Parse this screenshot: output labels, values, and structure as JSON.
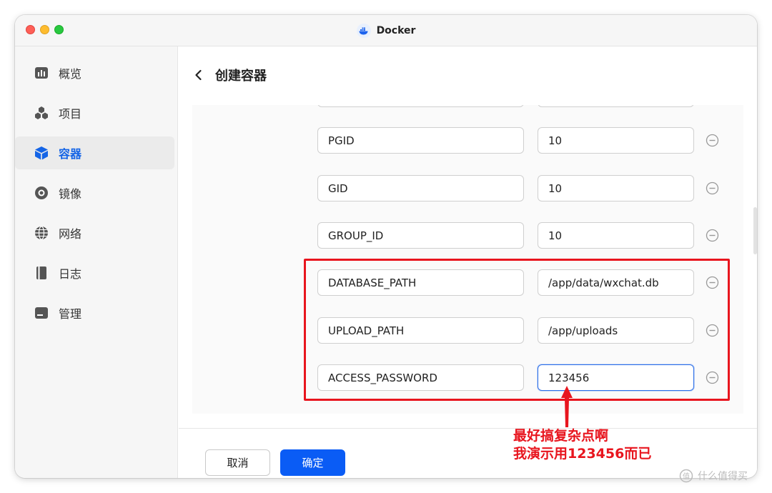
{
  "window": {
    "title": "Docker"
  },
  "sidebar": {
    "items": [
      {
        "label": "概览",
        "icon": "overview-chart-icon",
        "active": false
      },
      {
        "label": "项目",
        "icon": "project-cubes-icon",
        "active": false
      },
      {
        "label": "容器",
        "icon": "container-box-icon",
        "active": true
      },
      {
        "label": "镜像",
        "icon": "image-disc-icon",
        "active": false
      },
      {
        "label": "网络",
        "icon": "network-globe-icon",
        "active": false
      },
      {
        "label": "日志",
        "icon": "log-book-icon",
        "active": false
      },
      {
        "label": "管理",
        "icon": "manage-drive-icon",
        "active": false
      }
    ]
  },
  "header": {
    "title": "创建容器"
  },
  "env": {
    "rows": [
      {
        "key": "PGID",
        "value": "10",
        "focused": false
      },
      {
        "key": "GID",
        "value": "10",
        "focused": false
      },
      {
        "key": "GROUP_ID",
        "value": "10",
        "focused": false
      },
      {
        "key": "DATABASE_PATH",
        "value": "/app/data/wxchat.db",
        "focused": false
      },
      {
        "key": "UPLOAD_PATH",
        "value": "/app/uploads",
        "focused": false
      },
      {
        "key": "ACCESS_PASSWORD",
        "value": "123456",
        "focused": true
      }
    ]
  },
  "footer": {
    "cancel_label": "取消",
    "ok_label": "确定"
  },
  "annotation": {
    "line1": "最好搞复杂点啊",
    "line2": "我演示用123456而已"
  },
  "watermark": {
    "text": "什么值得买"
  },
  "colors": {
    "accent": "#0a5cf5",
    "active_nav": "#1565e6",
    "annotation_red": "#e8151e"
  }
}
